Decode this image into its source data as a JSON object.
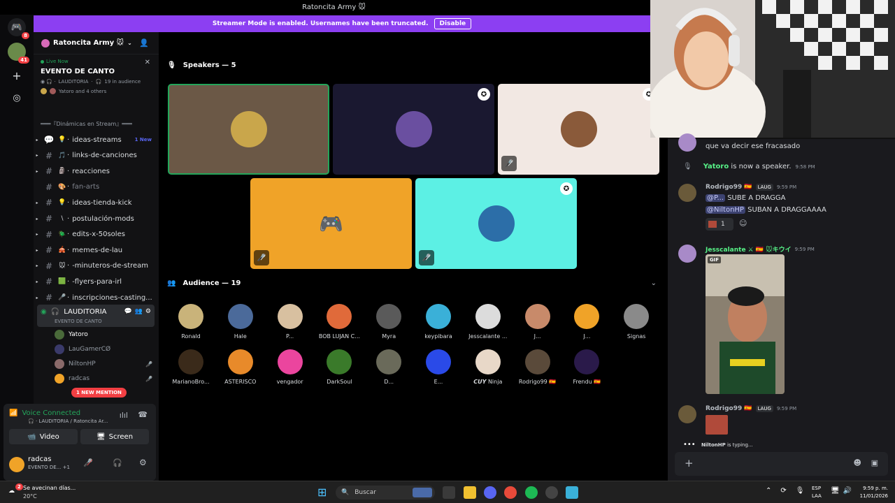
{
  "window": {
    "title": "Ratoncita Army 🐭"
  },
  "banner": {
    "text": "Streamer Mode is enabled. Usernames have been truncated.",
    "button": "Disable"
  },
  "rail": {
    "home_badge": "8",
    "server_badge": "41"
  },
  "server": {
    "name": "Ratoncita Army 🐭"
  },
  "live": {
    "status": "Live Now",
    "event": "EVENTO DE CANTO",
    "channel": "LAUDITORIA",
    "audience": "19 in audience",
    "others": "Yatoro and 4 others"
  },
  "category": "═══『Dinámicas en Stream』═══",
  "channels": [
    {
      "emoji": "💡",
      "name": "ideas-streams",
      "badge": "1 New",
      "type": "forum"
    },
    {
      "emoji": "🎵",
      "name": "links-de-canciones",
      "type": "text"
    },
    {
      "emoji": "🗿",
      "name": "reacciones",
      "type": "text"
    },
    {
      "emoji": "🎨",
      "name": "fan-arts",
      "type": "text",
      "muted": true
    },
    {
      "emoji": "💡",
      "name": "ideas-tienda-kick",
      "type": "text"
    },
    {
      "emoji": "\\",
      "name": "postulación-mods",
      "type": "text"
    },
    {
      "emoji": "🪲",
      "name": "edits-x-50soles",
      "type": "text"
    },
    {
      "emoji": "🎪",
      "name": "memes-de-lau",
      "type": "text"
    },
    {
      "emoji": "🐭",
      "name": "-minuteros-de-stream",
      "type": "text"
    },
    {
      "emoji": "🟩",
      "name": "-flyers-para-irl",
      "type": "text"
    },
    {
      "emoji": "🎤",
      "name": "inscripciones-casting...",
      "type": "text"
    }
  ],
  "voice_channel": {
    "name": "LAUDITORIA",
    "event": "EVENTO DE CANTO",
    "users": [
      "Yatoro",
      "LauGamerCØ",
      "NiltonHP",
      "radcas"
    ],
    "mention": "1 NEW MENTION"
  },
  "voice_panel": {
    "status": "Voice Connected",
    "location": "LAUDITORIA / Ratoncita Ar...",
    "video": "Video",
    "screen": "Screen",
    "user": "radcas",
    "user_status": "EVENTO DE... +1"
  },
  "stage": {
    "speakers_label": "Speakers — 5",
    "audience_label": "Audience — 19",
    "speakers": [
      {
        "bg": "#6b5846",
        "color": "#c9a64b",
        "selected": true,
        "muted": false
      },
      {
        "bg": "#1a1830",
        "color": "#6a4fa0",
        "star": true
      },
      {
        "bg": "#f2e8e3",
        "color": "#8a5a3a",
        "muted": true,
        "star": true
      },
      {
        "bg": "#f0a328",
        "color": "#f0a328",
        "muted": true,
        "discord": true
      },
      {
        "bg": "#5cf0e4",
        "color": "#2c6ea8",
        "muted": true,
        "star": true
      }
    ],
    "audience": [
      {
        "name": "Ronald",
        "color": "#c9b37a"
      },
      {
        "name": "Hale",
        "color": "#4b6a9a"
      },
      {
        "name": "P...",
        "color": "#d8c0a0"
      },
      {
        "name": "BOB LUJAN C...",
        "color": "#e06a3a"
      },
      {
        "name": "Myra",
        "color": "#5a5a5a"
      },
      {
        "name": "keypibara",
        "color": "#3ab0d8"
      },
      {
        "name": "Jesscalante ...",
        "color": "#dcdcdc"
      },
      {
        "name": "J...",
        "color": "#c88a6a"
      },
      {
        "name": "J...",
        "color": "#f0a328"
      },
      {
        "name": "Signas",
        "color": "#8a8a8a"
      },
      {
        "name": "MarianoBro...",
        "color": "#3a2a1a"
      },
      {
        "name": "ASTERISCO",
        "color": "#e88a2a"
      },
      {
        "name": "vengador",
        "color": "#eb459e"
      },
      {
        "name": "DarkSoul",
        "color": "#3a7a2a"
      },
      {
        "name": "D...",
        "color": "#6a6a5a"
      },
      {
        "name": "E...",
        "color": "#2a4ae8"
      },
      {
        "name": "𝘾𝙐𝙔 Ninja",
        "color": "#e8d8c8"
      },
      {
        "name": "Rodrigo99 🇪🇸",
        "color": "#5a4a3a"
      },
      {
        "name": "Frendu 🇪🇸",
        "color": "#2a1a4a"
      }
    ]
  },
  "chat": {
    "messages": [
      {
        "text": "que va decir ese fracasado"
      },
      {
        "system": "Yatoro",
        "system_text": " is now a speaker.",
        "time": "9:58 PM"
      },
      {
        "name": "Rodrigo99 🇪🇸",
        "tag": "LAUG",
        "time": "9:59 PM",
        "line1_mention": "@P...",
        "line1": " SUBE A DRAGGA",
        "line2_mention": "@NiltonHP",
        "line2": " SUBAN A DRAGGAAAA",
        "reaction_count": "1"
      },
      {
        "name": "Jesscalante ⚔ 🇪🇸 🐭キウイ",
        "time": "9:59 PM",
        "gif": "GIF"
      },
      {
        "name": "Rodrigo99 🇪🇸",
        "tag": "LAUG",
        "time": "9:59 PM"
      }
    ],
    "typing_user": "NiltonHP",
    "typing_text": " is typing..."
  },
  "taskbar": {
    "weather_text": "Se avecinan días...",
    "temp": "20°C",
    "search": "Buscar",
    "lang1": "ESP",
    "lang2": "LAA",
    "time": "9:59 p. m.",
    "date": "11/01/2026",
    "notif_badge": "2"
  }
}
